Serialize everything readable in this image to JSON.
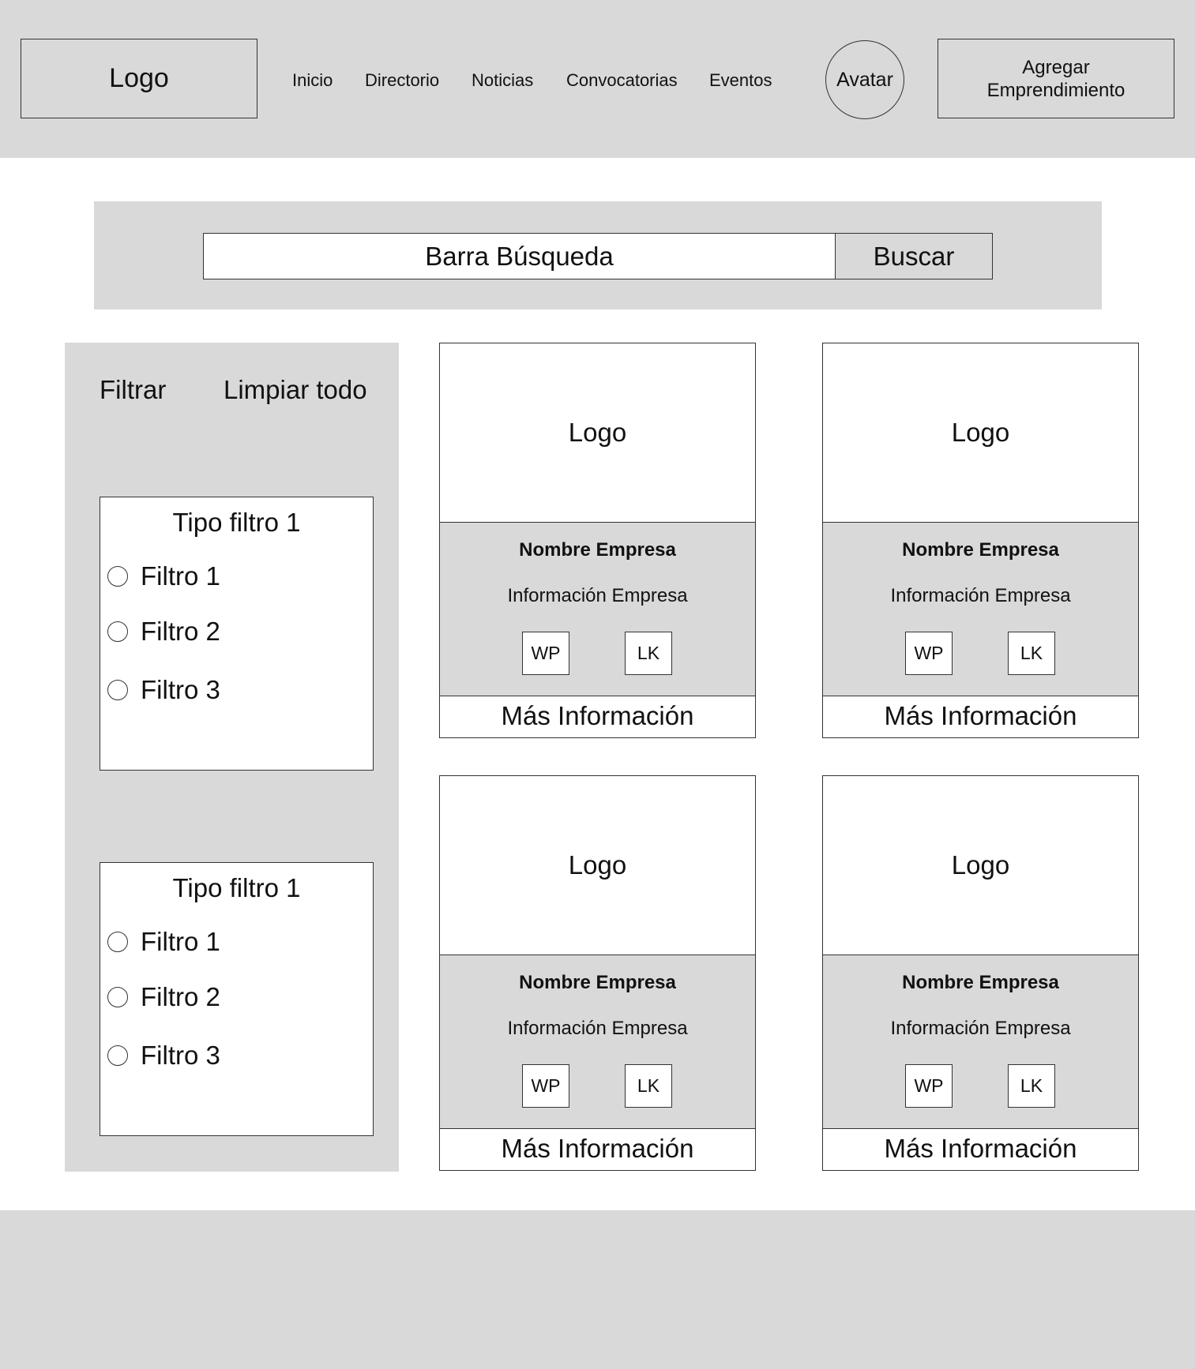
{
  "header": {
    "logo": "Logo",
    "nav": [
      "Inicio",
      "Directorio",
      "Noticias",
      "Convocatorias",
      "Eventos"
    ],
    "avatar": "Avatar",
    "add_button": "Agregar Emprendimiento"
  },
  "search": {
    "placeholder": "Barra Búsqueda",
    "button": "Buscar"
  },
  "sidebar": {
    "title": "Filtrar",
    "clear_all": "Limpiar todo",
    "groups": [
      {
        "title": "Tipo filtro 1",
        "options": [
          "Filtro 1",
          "Filtro 2",
          "Filtro 3"
        ]
      },
      {
        "title": "Tipo filtro 1",
        "options": [
          "Filtro 1",
          "Filtro 2",
          "Filtro 3"
        ]
      }
    ]
  },
  "cards": [
    {
      "logo": "Logo",
      "name": "Nombre Empresa",
      "info": "Información Empresa",
      "wp": "WP",
      "lk": "LK",
      "more": "Más Información"
    },
    {
      "logo": "Logo",
      "name": "Nombre Empresa",
      "info": "Información Empresa",
      "wp": "WP",
      "lk": "LK",
      "more": "Más Información"
    },
    {
      "logo": "Logo",
      "name": "Nombre Empresa",
      "info": "Información Empresa",
      "wp": "WP",
      "lk": "LK",
      "more": "Más Información"
    },
    {
      "logo": "Logo",
      "name": "Nombre Empresa",
      "info": "Información Empresa",
      "wp": "WP",
      "lk": "LK",
      "more": "Más Información"
    }
  ]
}
